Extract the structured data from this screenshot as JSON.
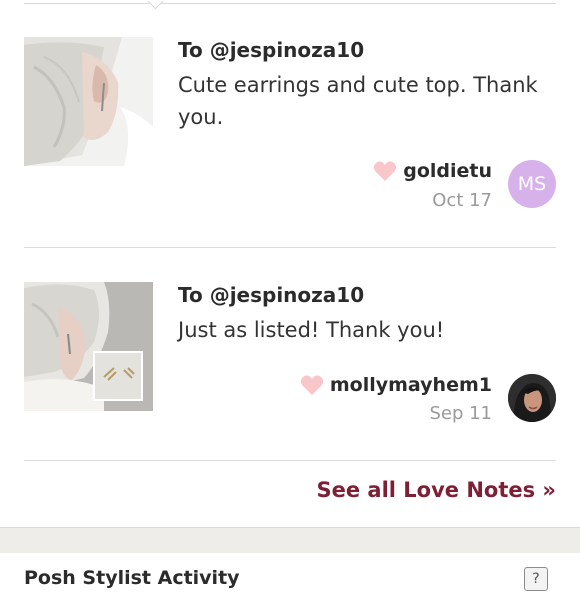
{
  "love_notes": [
    {
      "recipient": "To @jespinoza10",
      "message": "Cute earrings and cute top. Thank you.",
      "username": "goldietu",
      "date": "Oct 17",
      "avatar_initials": "MS"
    },
    {
      "recipient": "To @jespinoza10",
      "message": "Just as listed! Thank you!",
      "username": "mollymayhem1",
      "date": "Sep 11"
    }
  ],
  "see_all_link": "See all Love Notes »",
  "next_section": {
    "title": "Posh Stylist Activity",
    "help_label": "?"
  },
  "colors": {
    "accent": "#7d1f35",
    "heart": "#f9c6c9",
    "avatar_bg": "#d7b1ea"
  }
}
